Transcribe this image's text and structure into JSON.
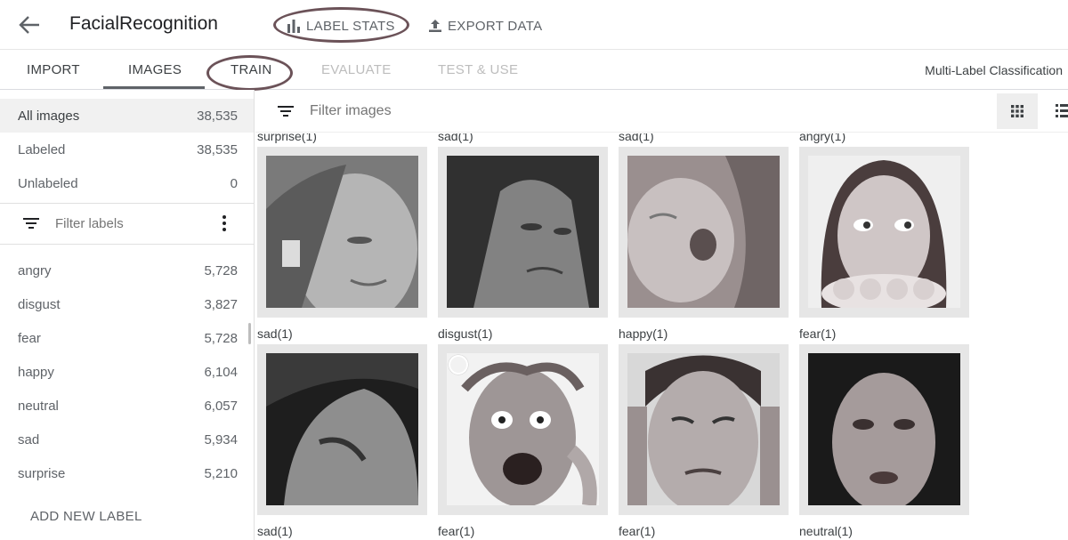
{
  "header": {
    "title": "FacialRecognition",
    "label_stats": "LABEL STATS",
    "export_data": "EXPORT DATA"
  },
  "tabs": [
    {
      "label": "IMPORT",
      "state": "normal"
    },
    {
      "label": "IMAGES",
      "state": "active"
    },
    {
      "label": "TRAIN",
      "state": "normal"
    },
    {
      "label": "EVALUATE",
      "state": "disabled"
    },
    {
      "label": "TEST & USE",
      "state": "disabled"
    }
  ],
  "mode": "Multi-Label Classification",
  "sidebar": {
    "filters": [
      {
        "label": "All images",
        "count": "38,535"
      },
      {
        "label": "Labeled",
        "count": "38,535"
      },
      {
        "label": "Unlabeled",
        "count": "0"
      }
    ],
    "label_filter_placeholder": "Filter labels",
    "labels": [
      {
        "label": "angry",
        "count": "5,728"
      },
      {
        "label": "disgust",
        "count": "3,827"
      },
      {
        "label": "fear",
        "count": "5,728"
      },
      {
        "label": "happy",
        "count": "6,104"
      },
      {
        "label": "neutral",
        "count": "6,057"
      },
      {
        "label": "sad",
        "count": "5,934"
      },
      {
        "label": "surprise",
        "count": "5,210"
      }
    ],
    "add_label": "ADD NEW LABEL"
  },
  "main": {
    "filter_placeholder": "Filter images",
    "rows": [
      [
        "surprise(1)",
        "sad(1)",
        "sad(1)",
        "angry(1)"
      ],
      [
        "sad(1)",
        "disgust(1)",
        "happy(1)",
        "fear(1)"
      ],
      [
        "sad(1)",
        "fear(1)",
        "fear(1)",
        "neutral(1)"
      ]
    ]
  },
  "colors": {
    "annotation_oval": "#6b5258",
    "selected_bg": "#f1f1f1",
    "thumb_frame": "#e6e6e6"
  },
  "icons": [
    "back-arrow-icon",
    "bar-chart-icon",
    "upload-icon",
    "filter-icon",
    "more-vert-icon",
    "grid-view-icon",
    "list-view-icon"
  ]
}
